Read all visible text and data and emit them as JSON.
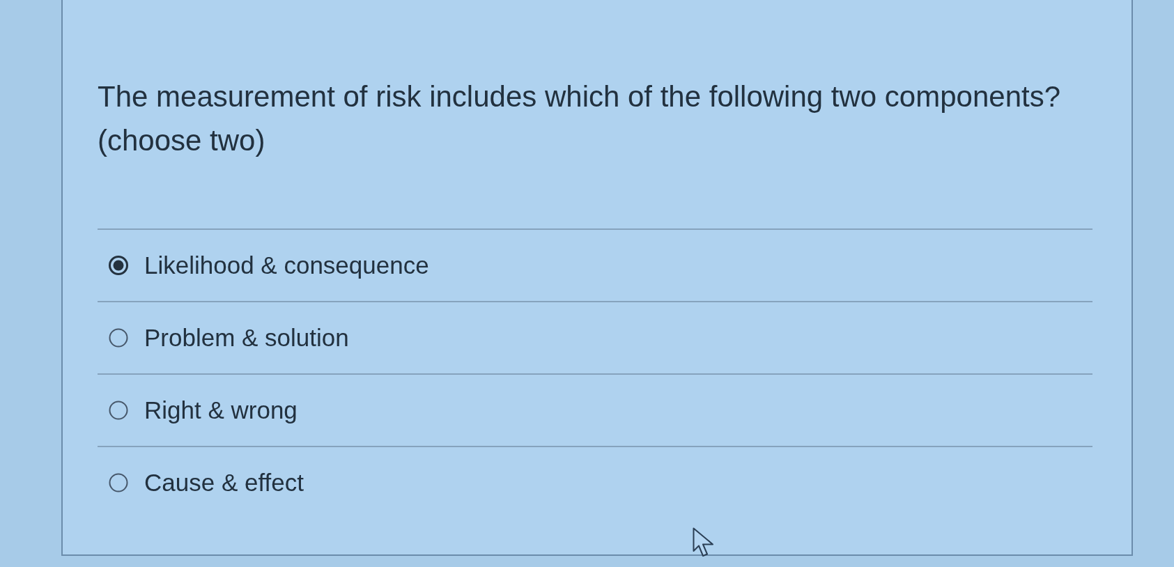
{
  "question": {
    "text": "The measurement of risk includes which of the following two components?",
    "note": "(choose two)"
  },
  "options": [
    {
      "label": "Likelihood & consequence",
      "selected": true
    },
    {
      "label": "Problem & solution",
      "selected": false
    },
    {
      "label": "Right & wrong",
      "selected": false
    },
    {
      "label": "Cause & effect",
      "selected": false
    }
  ]
}
